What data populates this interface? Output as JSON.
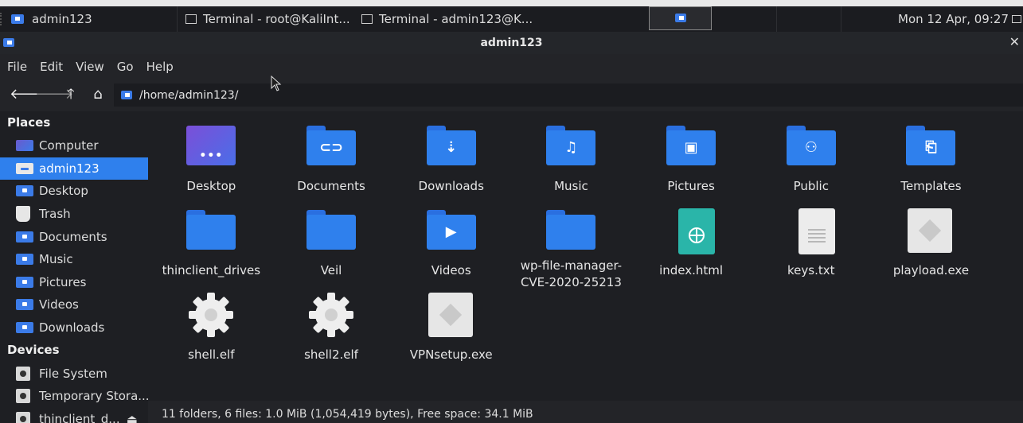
{
  "panel": {
    "active_task": "admin123",
    "tasks": [
      "Terminal - root@KaliInt...",
      "Terminal - admin123@K..."
    ],
    "clock": "Mon 12 Apr, 09:27"
  },
  "window": {
    "title": "admin123"
  },
  "menu": [
    "File",
    "Edit",
    "View",
    "Go",
    "Help"
  ],
  "toolbar": {
    "location": "/home/admin123/"
  },
  "sidebar": {
    "places_heading": "Places",
    "places": [
      {
        "label": "Computer",
        "icon": "computer-icon"
      },
      {
        "label": "admin123",
        "icon": "home-folder-icon",
        "active": true
      },
      {
        "label": "Desktop",
        "icon": "desktop-folder-icon"
      },
      {
        "label": "Trash",
        "icon": "trash-icon"
      },
      {
        "label": "Documents",
        "icon": "documents-folder-icon"
      },
      {
        "label": "Music",
        "icon": "music-folder-icon"
      },
      {
        "label": "Pictures",
        "icon": "pictures-folder-icon"
      },
      {
        "label": "Videos",
        "icon": "videos-folder-icon"
      },
      {
        "label": "Downloads",
        "icon": "downloads-folder-icon"
      }
    ],
    "devices_heading": "Devices",
    "devices": [
      {
        "label": "File System",
        "icon": "drive-icon"
      },
      {
        "label": "Temporary Stora...",
        "icon": "drive-icon"
      },
      {
        "label": "thinclient_d...",
        "icon": "drive-icon"
      }
    ]
  },
  "files": [
    {
      "name": "Desktop",
      "kind": "desktop"
    },
    {
      "name": "Documents",
      "kind": "folder",
      "glyph": "⊂⊃"
    },
    {
      "name": "Downloads",
      "kind": "folder",
      "glyph": "⇣"
    },
    {
      "name": "Music",
      "kind": "folder",
      "glyph": "♫"
    },
    {
      "name": "Pictures",
      "kind": "folder",
      "glyph": "▣"
    },
    {
      "name": "Public",
      "kind": "folder",
      "glyph": "⚇"
    },
    {
      "name": "Templates",
      "kind": "folder",
      "glyph": "⎗"
    },
    {
      "name": "thinclient_drives",
      "kind": "folder",
      "glyph": ""
    },
    {
      "name": "Veil",
      "kind": "folder",
      "glyph": ""
    },
    {
      "name": "Videos",
      "kind": "folder",
      "glyph": "▶"
    },
    {
      "name": "wp-file-manager-CVE-2020-25213",
      "kind": "folder",
      "glyph": ""
    },
    {
      "name": "index.html",
      "kind": "html"
    },
    {
      "name": "keys.txt",
      "kind": "text"
    },
    {
      "name": "playload.exe",
      "kind": "exe"
    },
    {
      "name": "shell.elf",
      "kind": "gear"
    },
    {
      "name": "shell2.elf",
      "kind": "gear"
    },
    {
      "name": "VPNsetup.exe",
      "kind": "exe"
    }
  ],
  "status": "11 folders, 6 files: 1.0 MiB (1,054,419 bytes), Free space: 34.1 MiB"
}
